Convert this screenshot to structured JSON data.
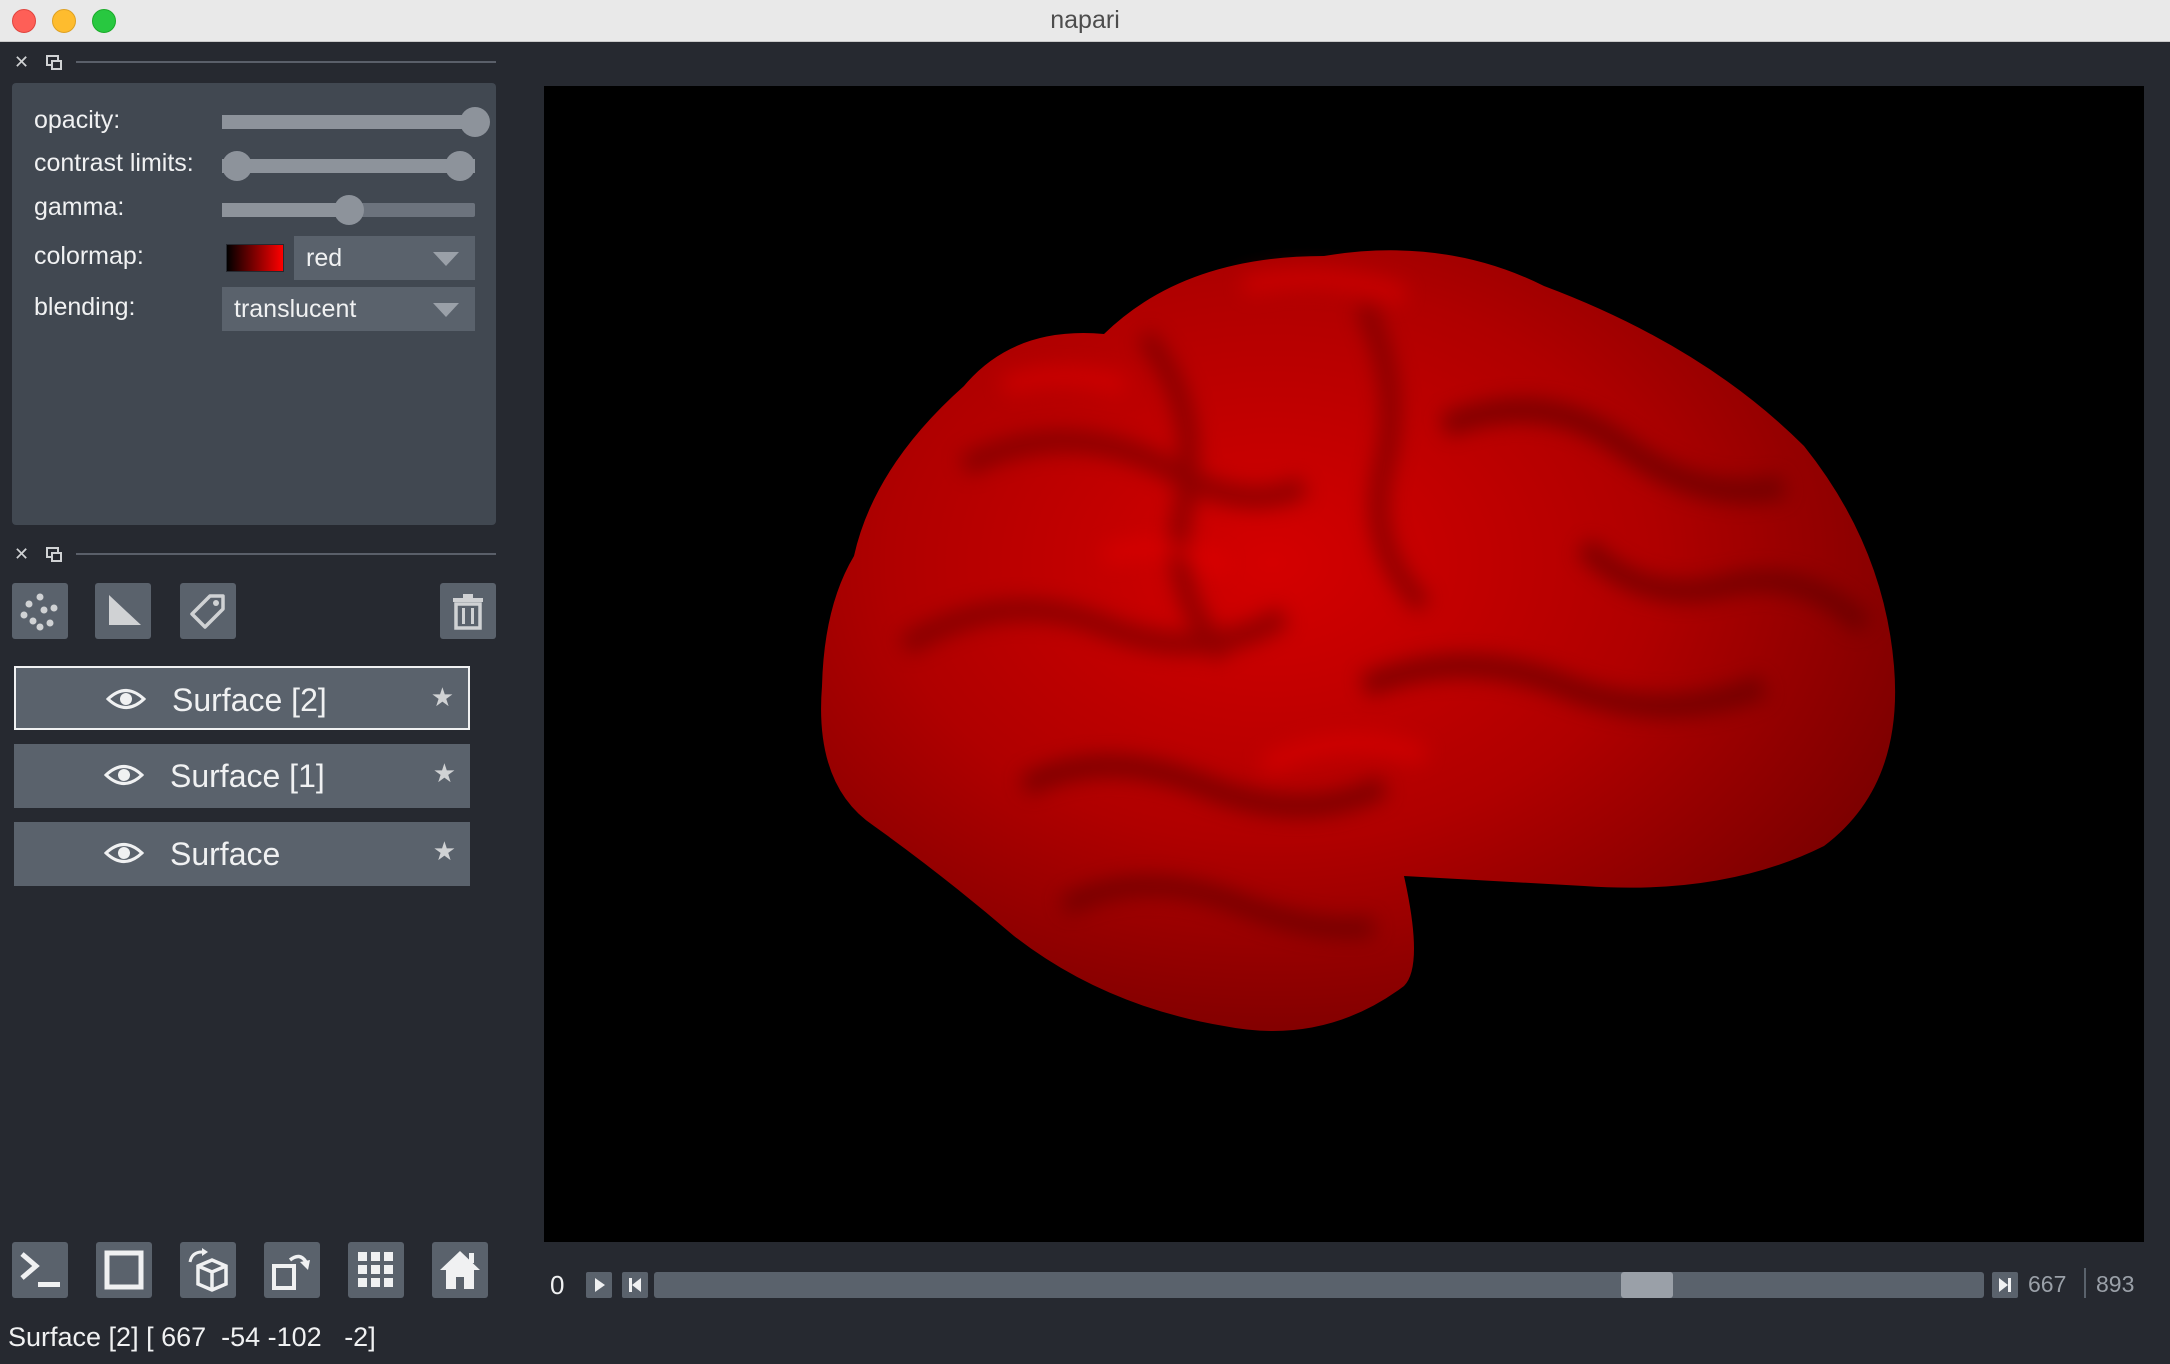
{
  "window": {
    "title": "napari"
  },
  "layer_controls": {
    "opacity_label": "opacity:",
    "opacity_value": 1.0,
    "contrast_label": "contrast limits:",
    "contrast_range": [
      0.0,
      1.0
    ],
    "gamma_label": "gamma:",
    "gamma_value": 0.5,
    "colormap_label": "colormap:",
    "colormap_value": "red",
    "blending_label": "blending:",
    "blending_value": "translucent"
  },
  "layer_tools": [
    "new-points-layer",
    "new-shapes-layer",
    "new-labels-layer",
    "delete-layer"
  ],
  "layers": [
    {
      "name": "Surface [2]",
      "selected": true
    },
    {
      "name": "Surface [1]",
      "selected": false
    },
    {
      "name": "Surface",
      "selected": false
    }
  ],
  "viewer_buttons": [
    "console",
    "ndisplay",
    "roll-dims",
    "transpose-dims",
    "grid-view",
    "home"
  ],
  "status": "Surface [2] [ 667  -54 -102   -2]",
  "dims_slider": {
    "start_label": "0",
    "current": 667,
    "current_label": "667",
    "max_label": "893",
    "max": 893
  },
  "colors": {
    "surface": "#cc0000",
    "background": "#262930",
    "canvas": "#000000"
  }
}
